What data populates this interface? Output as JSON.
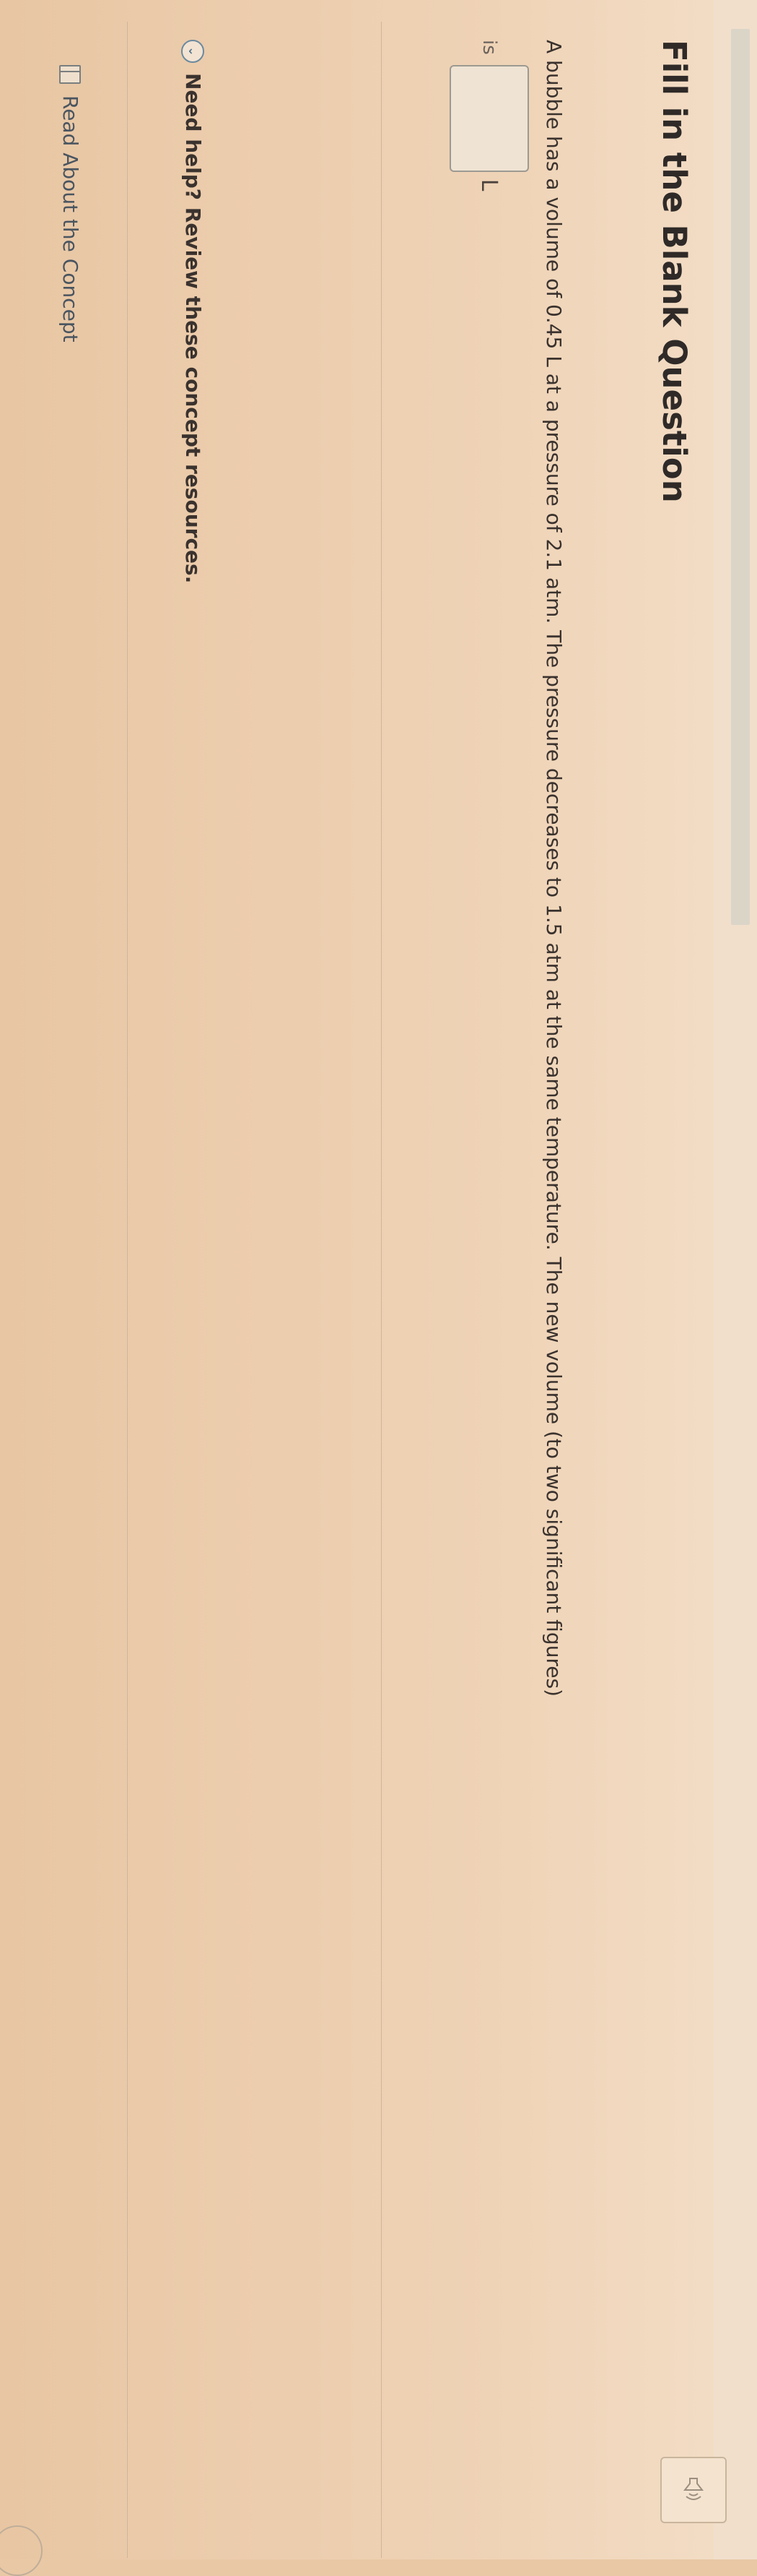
{
  "question": {
    "title": "Fill in the Blank Question",
    "text": "A bubble has a volume of 0.45 L at a pressure of 2.1 atm. The pressure decreases to 1.5 atm at the same temperature. The new volume (to two significant figures)",
    "answer_prefix": "is",
    "answer_value": "",
    "answer_unit": "L"
  },
  "help": {
    "label": "Need help? Review these concept resources.",
    "icon": "chevron-down-icon"
  },
  "resources": [
    {
      "label": "Read About the Concept",
      "icon": "book-icon"
    }
  ],
  "toolbar": {
    "audio_icon": "speaker-icon"
  }
}
